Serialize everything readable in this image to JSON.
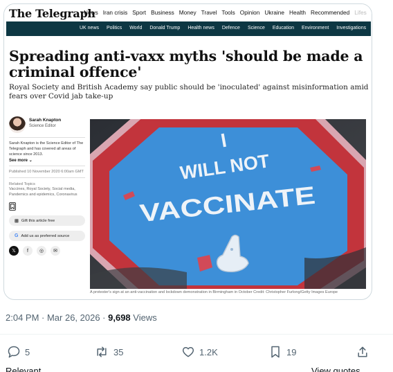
{
  "site": {
    "logo": "The Telegraph",
    "top_nav": [
      "News",
      "Iran crisis",
      "Sport",
      "Business",
      "Money",
      "Travel",
      "Tools",
      "Opinion",
      "Ukraine",
      "Health",
      "Recommended",
      "Lifes"
    ],
    "sub_nav": [
      "UK news",
      "Politics",
      "World",
      "Donald Trump",
      "Health news",
      "Defence",
      "Science",
      "Education",
      "Environment",
      "Investigations"
    ]
  },
  "article": {
    "headline": "Spreading anti-vaxx myths 'should be made a criminal offence'",
    "standfirst": "Royal Society and British Academy say public should be 'inoculated' against misinformation amid fears over Covid jab take-up",
    "author_name": "Sarah Knapton",
    "author_role": "Science Editor",
    "author_bio": "Sarah Knapton is the Science Editor of The Telegraph and has covered all areas of science since 2013.",
    "see_more": "See more",
    "published": "Published 10 November 2020 6:00am GMT",
    "related_topics_heading": "Related Topics",
    "related_topics": "Vaccines, Royal Society, Social media, Pandemics and epidemics, Coronavirus",
    "gift_label": "Gift this article free",
    "preferred_source_label": "Add us as preferred source",
    "sign_text": [
      "I",
      "WILL NOT",
      "VACCINATE"
    ],
    "caption": "A protester's sign at an anti-vaccination and lockdown demonstration in Birmingham in October",
    "credit": "Credit: Christopher Furlong/Getty Images Europe"
  },
  "tweet": {
    "time": "2:04 PM · Mar 26, 2026 · ",
    "views_count": "9,698",
    "views_label": " Views",
    "replies": "5",
    "reposts": "35",
    "likes": "1.2K",
    "bookmarks": "19",
    "relevant_label": "Relevant",
    "view_quotes_label": "View quotes"
  },
  "icons": [
    "share-icon",
    "bookmark-icon",
    "gift-icon",
    "google-icon",
    "x-icon",
    "facebook-icon",
    "whatsapp-icon",
    "email-icon",
    "reply-icon",
    "repost-icon",
    "like-icon",
    "bookmark-icon",
    "upload-icon"
  ],
  "colors": {
    "subnav_bg": "#0d3743",
    "muted_text": "#536471",
    "sign_blue": "#3d8fd8",
    "sign_red": "#c2343c"
  }
}
